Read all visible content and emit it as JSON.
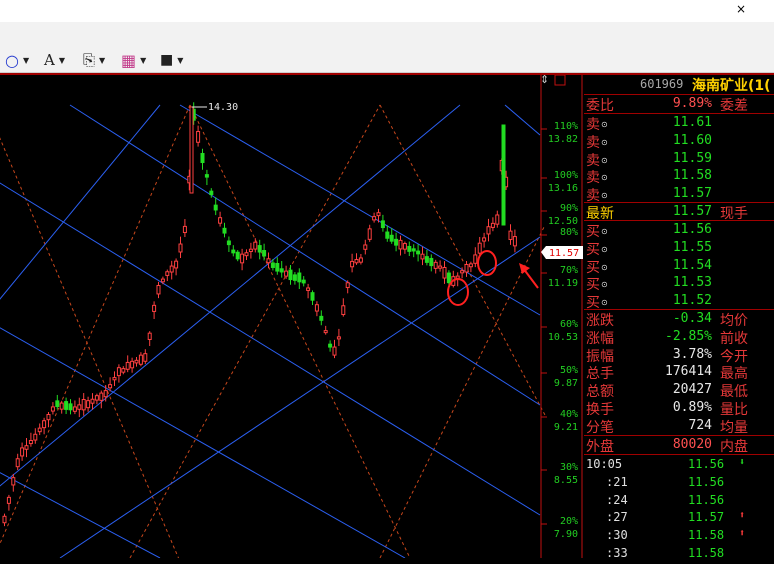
{
  "window": {
    "close_glyph": "×"
  },
  "toolbar": {
    "items": [
      {
        "icon": "circle-draw-icon",
        "glyph": "○",
        "dropdown": "▼"
      },
      {
        "icon": "text-font-icon",
        "glyph": "A",
        "dropdown": "▼"
      },
      {
        "icon": "copy-icon",
        "glyph": "⎘",
        "dropdown": "▼"
      },
      {
        "icon": "color-grid-icon",
        "glyph": "▦",
        "dropdown": "▼"
      },
      {
        "icon": "save-disk-icon",
        "glyph": "■",
        "dropdown": "▼"
      }
    ]
  },
  "chart_controls": {
    "crosshair": "⇕"
  },
  "chart_data": {
    "type": "candlestick",
    "high_label": "14.30",
    "current_price_label": "11.57",
    "y_ticks": [
      {
        "pct": "110%",
        "price": "13.82",
        "value": 13.82
      },
      {
        "pct": "100%",
        "price": "13.16",
        "value": 13.16
      },
      {
        "pct": "90%",
        "price": "12.50",
        "value": 12.5
      },
      {
        "pct": "80%",
        "price": "",
        "value": 12.1
      },
      {
        "pct": "70%",
        "price": "11.19",
        "value": 11.19
      },
      {
        "pct": "60%",
        "price": "10.53",
        "value": 10.53
      },
      {
        "pct": "50%",
        "price": "9.87",
        "value": 9.87
      },
      {
        "pct": "40%",
        "price": "9.21",
        "value": 9.21
      },
      {
        "pct": "30%",
        "price": "8.55",
        "value": 8.55
      },
      {
        "pct": "20%",
        "price": "7.90",
        "value": 7.9
      }
    ],
    "colors": {
      "up": "#ff4040",
      "down": "#22dd22",
      "channel": "#2b5ff0",
      "fan": "#c8471c",
      "circle": "#ff2020"
    }
  },
  "quote": {
    "code": "601969",
    "name": "海南矿业(1(",
    "webi_label": "委比",
    "webi_value": "9.89%",
    "wecha_label": "委差",
    "asks": [
      {
        "label": "卖",
        "price": "11.61"
      },
      {
        "label": "卖",
        "price": "11.60"
      },
      {
        "label": "卖",
        "price": "11.59"
      },
      {
        "label": "卖",
        "price": "11.58"
      },
      {
        "label": "卖",
        "price": "11.57"
      }
    ],
    "latest_label": "最新",
    "latest_value": "11.57",
    "xianshou_label": "现手",
    "bids": [
      {
        "label": "买",
        "price": "11.56"
      },
      {
        "label": "买",
        "price": "11.55"
      },
      {
        "label": "买",
        "price": "11.54"
      },
      {
        "label": "买",
        "price": "11.53"
      },
      {
        "label": "买",
        "price": "11.52"
      }
    ],
    "stats": [
      {
        "label": "涨跌",
        "value": "-0.34",
        "color": "#22dd22",
        "right": "均价"
      },
      {
        "label": "涨幅",
        "value": "-2.85%",
        "color": "#22dd22",
        "right": "前收"
      },
      {
        "label": "振幅",
        "value": "3.78%",
        "color": "#e8e8e8",
        "right": "今开"
      },
      {
        "label": "总手",
        "value": "176414",
        "color": "#e8e8e8",
        "right": "最高"
      },
      {
        "label": "总额",
        "value": "20427",
        "color": "#e8e8e8",
        "right": "最低"
      },
      {
        "label": "换手",
        "value": "0.89%",
        "color": "#e8e8e8",
        "right": "量比"
      },
      {
        "label": "分笔",
        "value": "724",
        "color": "#e8e8e8",
        "right": "均量"
      }
    ],
    "outer_label": "外盘",
    "outer_value": "80020",
    "inner_label": "内盘",
    "ticks": [
      {
        "time": "10:05",
        "price": "11.56",
        "arrow": "⬇"
      },
      {
        "time": ":21",
        "price": "11.56",
        "arrow": ""
      },
      {
        "time": ":24",
        "price": "11.56",
        "arrow": ""
      },
      {
        "time": ":27",
        "price": "11.57",
        "arrow": "⬆"
      },
      {
        "time": ":30",
        "price": "11.58",
        "arrow": "⬆"
      },
      {
        "time": ":33",
        "price": "11.58",
        "arrow": ""
      }
    ]
  }
}
